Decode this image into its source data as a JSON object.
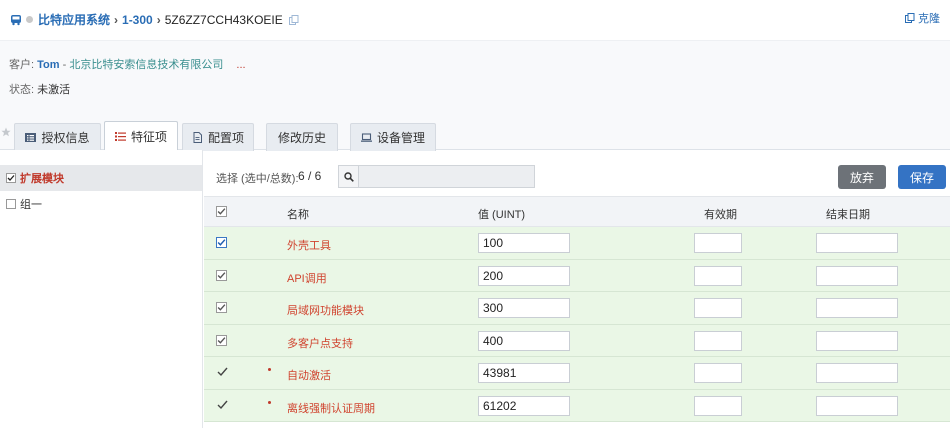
{
  "breadcrumb": {
    "app": "比特应用系统",
    "range": "1-300",
    "license_id": "5Z6ZZ7CCH43KOEIE"
  },
  "header": {
    "clone_label": "克隆"
  },
  "customer": {
    "label": "客户:",
    "name": "Tom",
    "dash": "-",
    "company": "北京比特安索信息技术有限公司",
    "more": "...",
    "status_label": "状态:",
    "status": "未激活"
  },
  "tabs": [
    {
      "label": "授权信息",
      "icon": "list-icon",
      "active": false
    },
    {
      "label": "特征项",
      "icon": "bulleted-list-icon",
      "active": true
    },
    {
      "label": "配置项",
      "icon": "document-icon",
      "active": false
    },
    {
      "label": "修改历史",
      "icon": "",
      "active": false
    },
    {
      "label": "设备管理",
      "icon": "laptop-icon",
      "active": false
    }
  ],
  "sidebar": {
    "items": [
      {
        "label": "扩展模块",
        "checked": true,
        "active": true
      },
      {
        "label": "组一",
        "checked": false,
        "active": false
      }
    ]
  },
  "toolbar": {
    "selection_label": "选择 (选中/总数):",
    "selection_count": "6 / 6",
    "search_placeholder": "",
    "discard_label": "放弃",
    "save_label": "保存"
  },
  "table": {
    "columns": {
      "name": "名称",
      "value": "值 (UINT)",
      "validity": "有效期",
      "end_date": "结束日期"
    },
    "rows": [
      {
        "name": "外壳工具",
        "value": "100",
        "style": "checkbox-blue",
        "bullet": false
      },
      {
        "name": "API调用",
        "value": "200",
        "style": "checkbox",
        "bullet": false
      },
      {
        "name": "局域网功能模块",
        "value": "300",
        "style": "checkbox",
        "bullet": false
      },
      {
        "name": "多客户点支持",
        "value": "400",
        "style": "checkbox",
        "bullet": false
      },
      {
        "name": "自动激活",
        "value": "43981",
        "style": "tick",
        "bullet": true
      },
      {
        "name": "离线强制认证周期",
        "value": "61202",
        "style": "tick",
        "bullet": true
      }
    ]
  },
  "colors": {
    "link": "#2a6db5",
    "accent_red": "#d0432e",
    "row_green": "#eaf7e6",
    "save": "#3473c4",
    "discard": "#6d7278"
  }
}
